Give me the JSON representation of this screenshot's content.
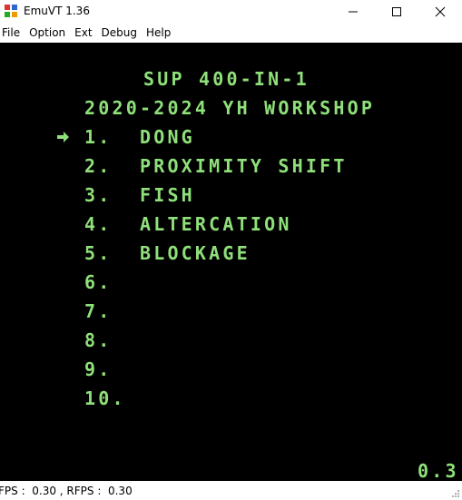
{
  "window": {
    "title": "EmuVT 1.36"
  },
  "menu": [
    "File",
    "Option",
    "Ext",
    "Debug",
    "Help"
  ],
  "screen": {
    "title": "SUP 400-IN-1",
    "subtitle": "2020-2024 YH WORKSHOP",
    "items": [
      "1.  DONG",
      "2.  PROXIMITY SHIFT",
      "3.  FISH",
      "4.  ALTERCATION",
      "5.  BLOCKAGE",
      "6.",
      "7.",
      "8.",
      "9.",
      "10."
    ],
    "selected_index": 0,
    "corner_text": "0.3",
    "text_color": "#8fe07a",
    "cursor_icon": "arrow-right-icon"
  },
  "status": {
    "text": "FPS :  0.30 , RFPS :  0.30"
  }
}
